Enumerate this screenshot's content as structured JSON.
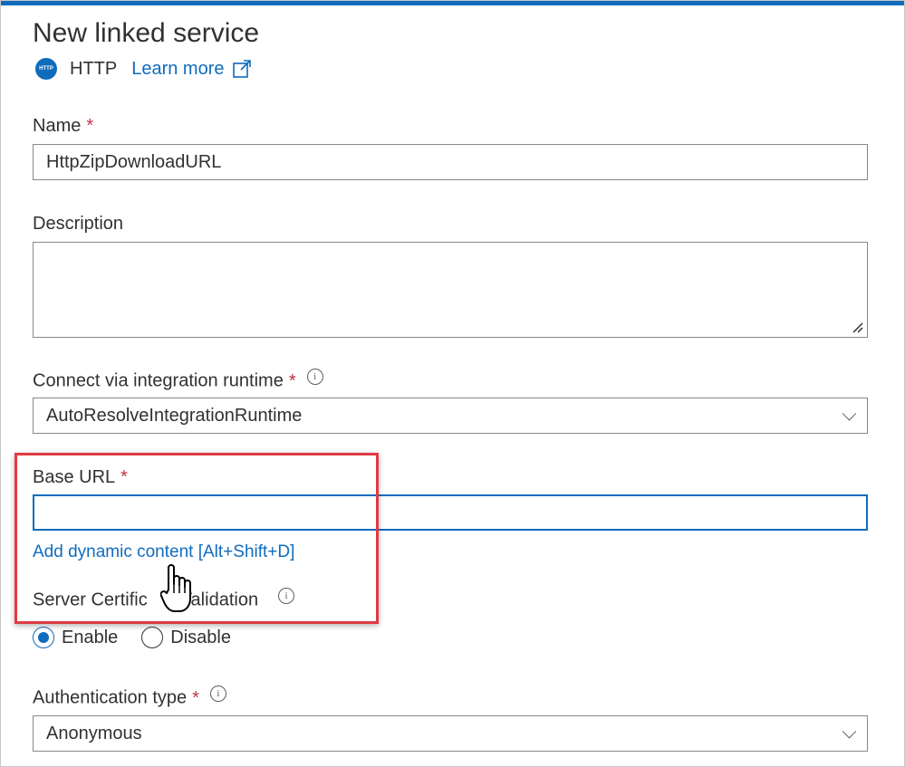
{
  "panel": {
    "title": "New linked service",
    "service_type": "HTTP",
    "learn_more": "Learn more"
  },
  "fields": {
    "name": {
      "label": "Name",
      "required": "*",
      "value": "HttpZipDownloadURL"
    },
    "description": {
      "label": "Description",
      "value": ""
    },
    "integration_runtime": {
      "label": "Connect via integration runtime",
      "required": "*",
      "value": "AutoResolveIntegrationRuntime"
    },
    "base_url": {
      "label": "Base URL",
      "required": "*",
      "value": "",
      "dynamic_link": "Add dynamic content [Alt+Shift+D]"
    },
    "server_cert": {
      "label_part1": "Server Certific",
      "label_part2": "Validation",
      "options": [
        "Enable",
        "Disable"
      ],
      "selected": "Enable"
    },
    "auth_type": {
      "label": "Authentication type",
      "required": "*",
      "value": "Anonymous"
    }
  },
  "icons": {
    "info": "i",
    "globe_text": "HTTP"
  },
  "colors": {
    "accent": "#0f6cbd",
    "required": "#c4314b",
    "highlight": "#e03a43"
  }
}
